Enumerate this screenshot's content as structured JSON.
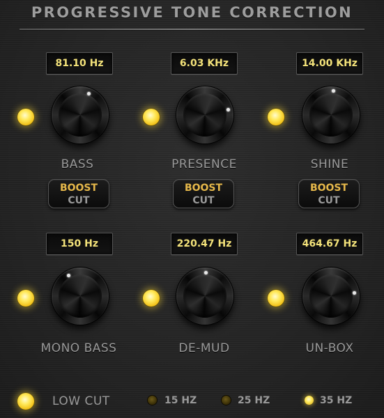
{
  "title": "PROGRESSIVE TONE CORRECTION",
  "top_row": [
    {
      "display": "81.10 Hz",
      "label": "BASS",
      "boost": "BOOST",
      "cut": "CUT"
    },
    {
      "display": "6.03 KHz",
      "label": "PRESENCE",
      "boost": "BOOST",
      "cut": "CUT"
    },
    {
      "display": "14.00 KHz",
      "label": "SHINE",
      "boost": "BOOST",
      "cut": "CUT"
    }
  ],
  "bottom_row": [
    {
      "display": "150 Hz",
      "label": "MONO BASS"
    },
    {
      "display": "220.47 Hz",
      "label": "DE-MUD"
    },
    {
      "display": "464.67 Hz",
      "label": "UN-BOX"
    }
  ],
  "low_cut": {
    "label": "LOW CUT",
    "options": [
      {
        "label": "15 HZ",
        "active": false
      },
      {
        "label": "25 HZ",
        "active": false
      },
      {
        "label": "35 HZ",
        "active": true
      }
    ]
  },
  "colors": {
    "display_text": "#f3e27a",
    "boost_text": "#e6b84a",
    "led_on": "#ffe95a",
    "label_text": "#9a9a9a"
  },
  "icons": {
    "led": "led-indicator",
    "knob": "rotary-knob"
  }
}
